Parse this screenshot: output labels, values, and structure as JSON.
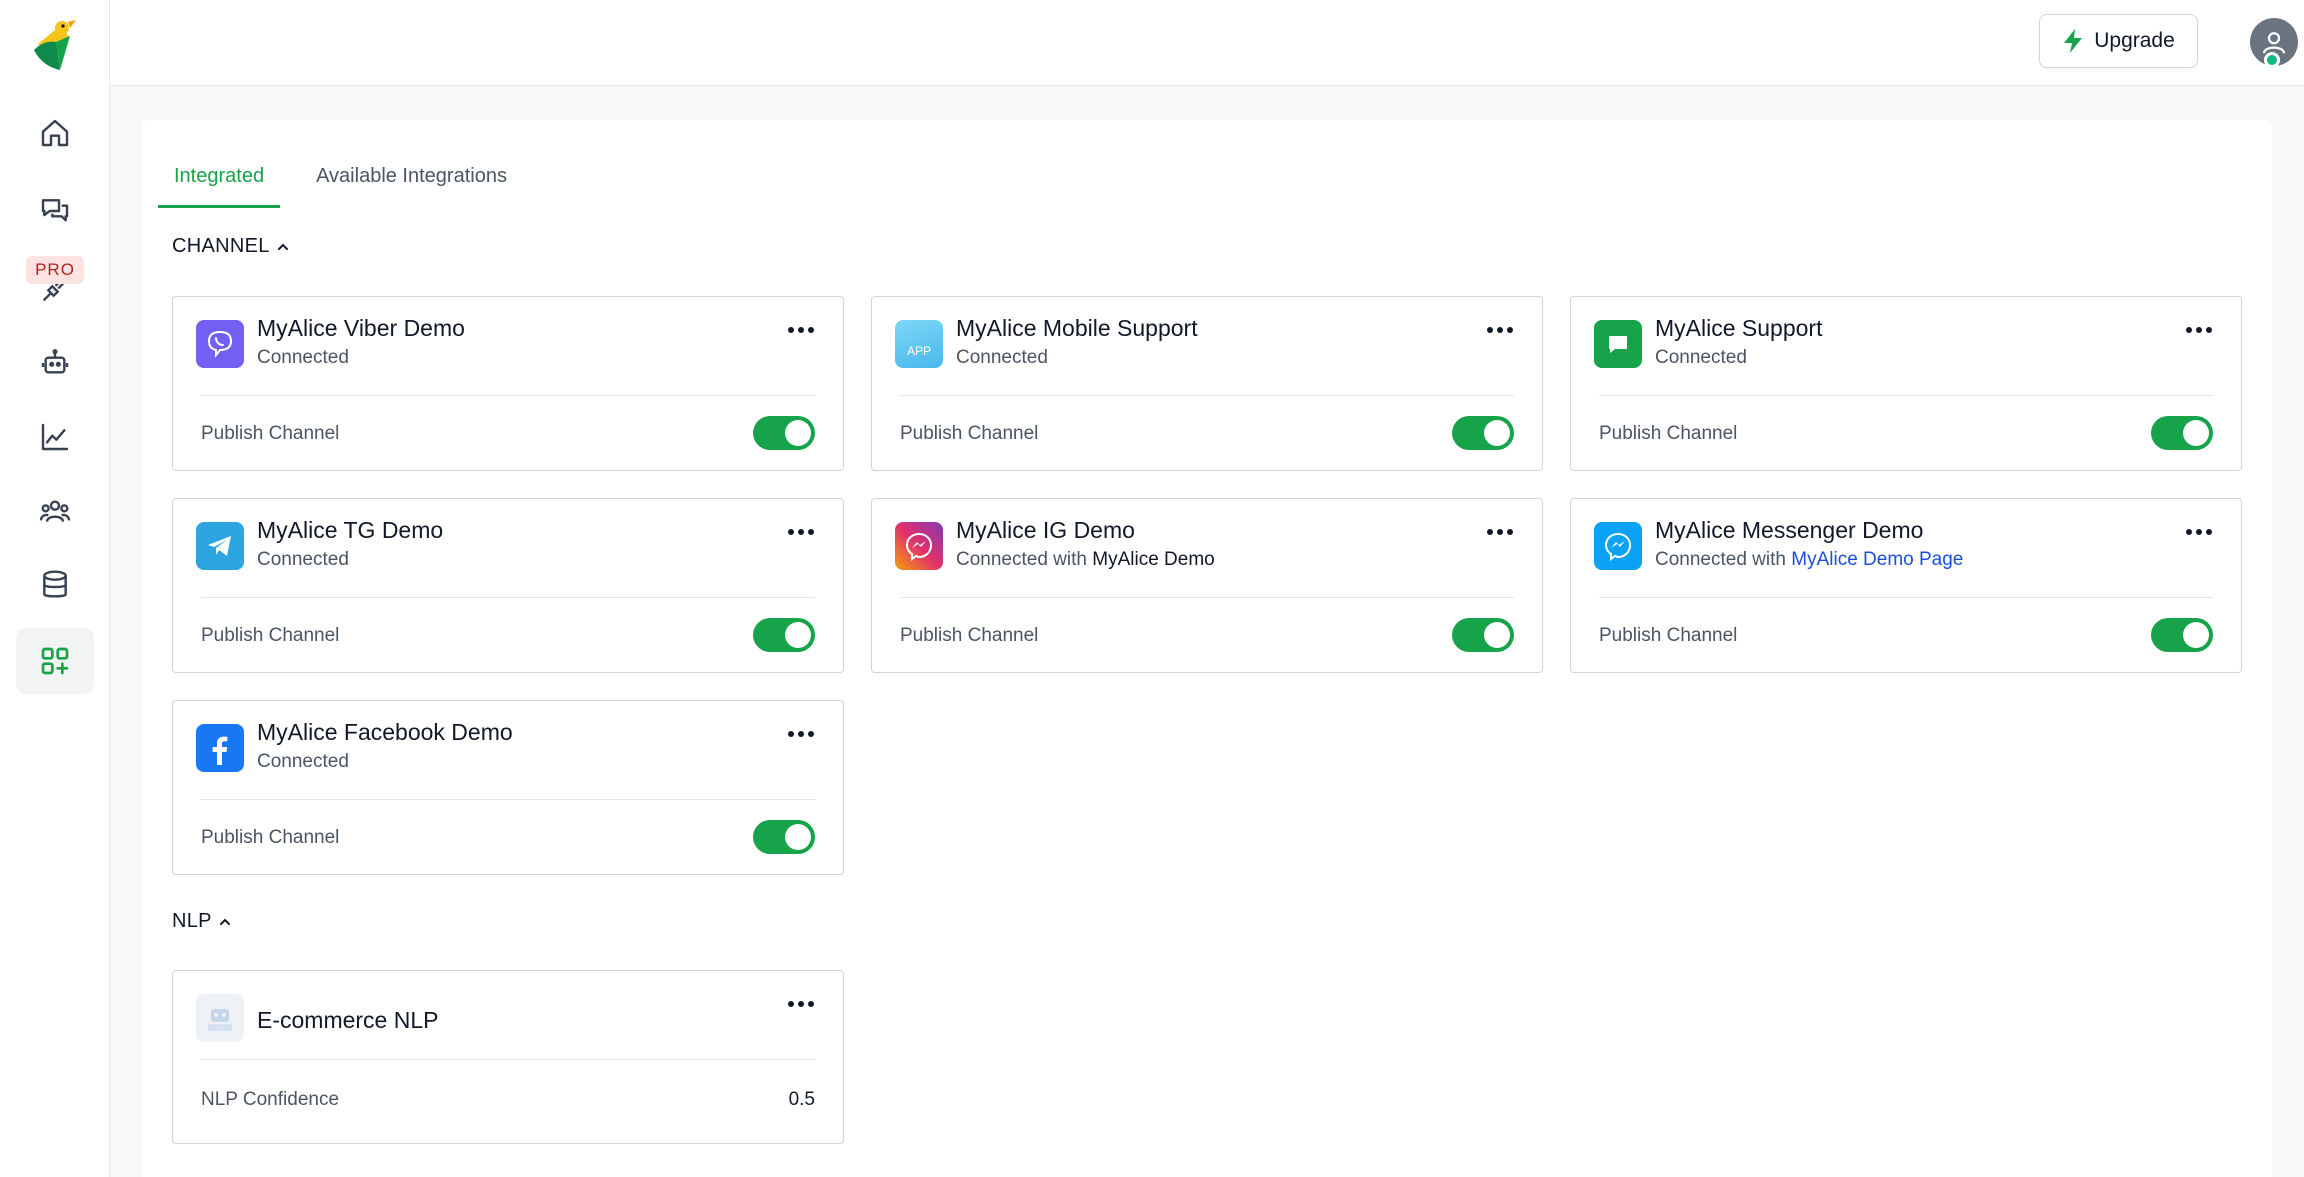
{
  "sidebar": {
    "pro_badge": "PRO",
    "items": [
      {
        "icon": "home-icon"
      },
      {
        "icon": "chat-icon"
      },
      {
        "icon": "plug-icon"
      },
      {
        "icon": "bot-icon"
      },
      {
        "icon": "analytics-icon"
      },
      {
        "icon": "team-icon"
      },
      {
        "icon": "database-icon"
      },
      {
        "icon": "integrations-icon",
        "active": true
      }
    ]
  },
  "header": {
    "upgrade_label": "Upgrade"
  },
  "tabs": [
    {
      "label": "Integrated",
      "active": true
    },
    {
      "label": "Available Integrations",
      "active": false
    }
  ],
  "sections": {
    "channel": {
      "title": "CHANNEL"
    },
    "nlp": {
      "title": "NLP"
    }
  },
  "channels": [
    {
      "title": "MyAlice Viber Demo",
      "status": "Connected",
      "footer": "Publish Channel",
      "icon": "viber-icon",
      "color": "#7360f2",
      "published": true
    },
    {
      "title": "MyAlice Mobile Support",
      "status": "Connected",
      "footer": "Publish Channel",
      "icon": "app-icon",
      "color": "#5ec8f2",
      "published": true
    },
    {
      "title": "MyAlice Support",
      "status": "Connected",
      "footer": "Publish Channel",
      "icon": "livechat-icon",
      "color": "#16a34a",
      "published": true
    },
    {
      "title": "MyAlice TG Demo",
      "status": "Connected",
      "footer": "Publish Channel",
      "icon": "telegram-icon",
      "color": "#2ca5e0",
      "published": true
    },
    {
      "title": "MyAlice IG Demo",
      "status_prefix": "Connected with ",
      "status_target": "MyAlice Demo",
      "footer": "Publish Channel",
      "icon": "instagram-messenger-icon",
      "color": "#e1306c",
      "published": true
    },
    {
      "title": "MyAlice Messenger Demo",
      "status_prefix": "Connected with ",
      "status_link": "MyAlice Demo Page",
      "footer": "Publish Channel",
      "icon": "messenger-icon",
      "color": "#0aa2f5",
      "published": true
    },
    {
      "title": "MyAlice Facebook Demo",
      "status": "Connected",
      "footer": "Publish Channel",
      "icon": "facebook-icon",
      "color": "#1877f2",
      "published": true
    }
  ],
  "nlp": [
    {
      "title": "E-commerce NLP",
      "footer": "NLP Confidence",
      "value": "0.5",
      "icon": "nlp-bot-icon"
    }
  ]
}
